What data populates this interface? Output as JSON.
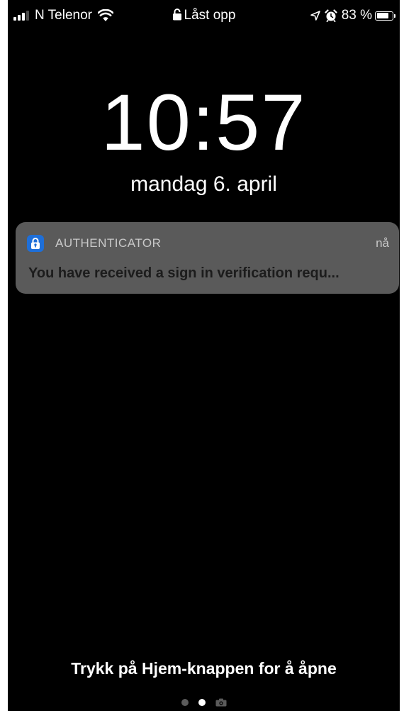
{
  "status_bar": {
    "carrier": "N Telenor",
    "signal_bars_active": 3,
    "lock_status": "Låst opp",
    "battery_percent_label": "83 %",
    "battery_level": 0.83,
    "icons": [
      "cellular-signal-icon",
      "wifi-icon",
      "lock-icon",
      "location-arrow-icon",
      "alarm-clock-icon",
      "battery-icon"
    ]
  },
  "lock_screen": {
    "time": "10:57",
    "date": "mandag 6. april"
  },
  "notification": {
    "app_name": "AUTHENTICATOR",
    "time": "nå",
    "message": "You have received a sign in verification requ...",
    "icon": "authenticator-lock-icon",
    "icon_color": "#1e6fd9"
  },
  "bottom": {
    "hint": "Trykk på Hjem-knappen for å åpne",
    "pages": 3,
    "active_page": 1
  },
  "colors": {
    "background": "#000000",
    "notification_bg": "#5a5a5a",
    "text": "#ffffff"
  }
}
